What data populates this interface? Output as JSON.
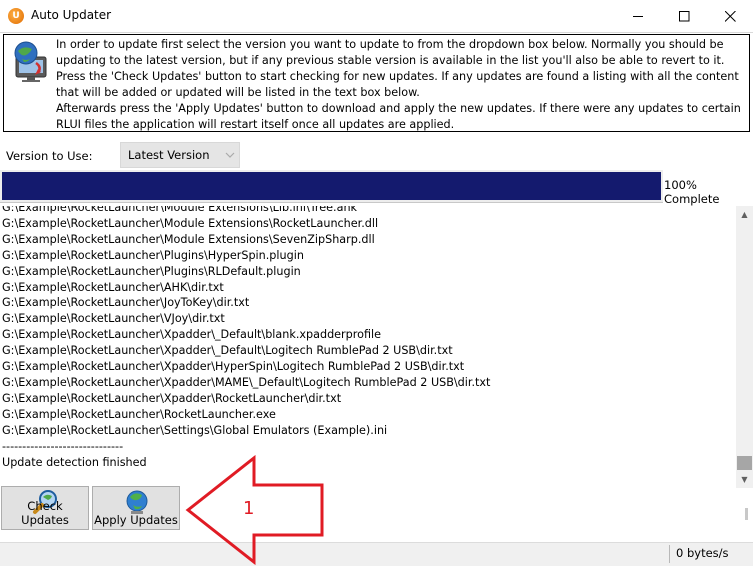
{
  "window": {
    "title": "Auto Updater",
    "app_icon": "updater-app-icon",
    "controls": [
      "minimize-icon",
      "maximize-icon",
      "close-icon"
    ]
  },
  "info": {
    "icon": "globe-monitor-icon",
    "paragraphs": [
      "In order to update first select the version you want to update to from the dropdown box below. Normally you should be updating to the latest version, but if any previous stable version is available in the list you'll also be able to revert to it.",
      "Press the 'Check Updates' button to start checking for new updates. If any updates are found a listing with all the content that will be added or updated will be listed in the text box below.",
      "Afterwards press the 'Apply Updates' button to download and apply the new updates. If there were any updates to certain RLUI files the application will restart itself once all updates are applied."
    ]
  },
  "version": {
    "label": "Version to Use:",
    "selected": "Latest Version"
  },
  "progress": {
    "value": 100,
    "label": "100% Complete",
    "fill_color": "#141a6e"
  },
  "log": {
    "lines": [
      "G:\\Example\\RocketLauncher\\Module Extensions\\Lib.ini\\Tree.ahk",
      "G:\\Example\\RocketLauncher\\Module Extensions\\RocketLauncher.dll",
      "G:\\Example\\RocketLauncher\\Module Extensions\\SevenZipSharp.dll",
      "G:\\Example\\RocketLauncher\\Plugins\\HyperSpin.plugin",
      "G:\\Example\\RocketLauncher\\Plugins\\RLDefault.plugin",
      "G:\\Example\\RocketLauncher\\AHK\\dir.txt",
      "G:\\Example\\RocketLauncher\\JoyToKey\\dir.txt",
      "G:\\Example\\RocketLauncher\\VJoy\\dir.txt",
      "G:\\Example\\RocketLauncher\\Xpadder\\_Default\\blank.xpadderprofile",
      "G:\\Example\\RocketLauncher\\Xpadder\\_Default\\Logitech RumblePad 2 USB\\dir.txt",
      "G:\\Example\\RocketLauncher\\Xpadder\\HyperSpin\\Logitech RumblePad 2 USB\\dir.txt",
      "G:\\Example\\RocketLauncher\\Xpadder\\MAME\\_Default\\Logitech RumblePad 2 USB\\dir.txt",
      "G:\\Example\\RocketLauncher\\Xpadder\\RocketLauncher\\dir.txt",
      "G:\\Example\\RocketLauncher\\RocketLauncher.exe",
      "G:\\Example\\RocketLauncher\\Settings\\Global Emulators (Example).ini",
      "------------------------------",
      "Update detection finished"
    ]
  },
  "buttons": {
    "check": {
      "label": "Check Updates",
      "icon": "magnifier-globe-icon"
    },
    "apply": {
      "label": "Apply Updates",
      "icon": "globe-icon"
    }
  },
  "status": {
    "speed": "0 bytes/s"
  },
  "annotation": {
    "number": "1",
    "color": "#e01b24"
  }
}
